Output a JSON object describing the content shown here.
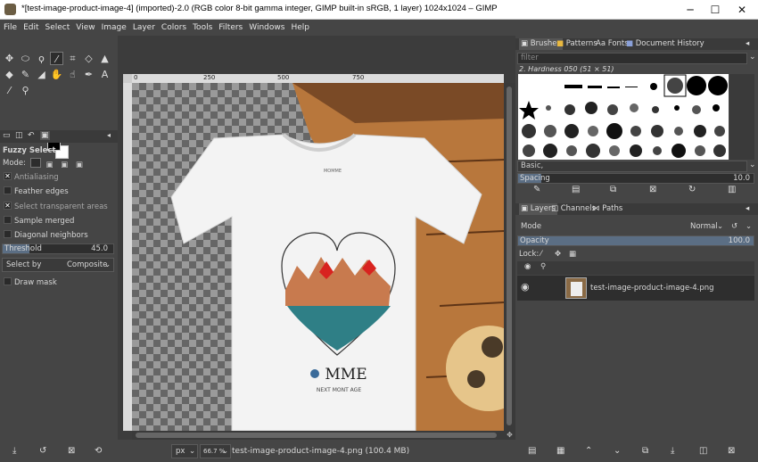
{
  "window": {
    "title": "*[test-image-product-image-4] (imported)-2.0 (RGB color 8-bit gamma integer, GIMP built-in sRGB, 1 layer) 1024x1024 – GIMP",
    "minimize_glyph": "─",
    "maximize_glyph": "☐",
    "close_glyph": "✕"
  },
  "menu": [
    "File",
    "Edit",
    "Select",
    "View",
    "Image",
    "Layer",
    "Colors",
    "Tools",
    "Filters",
    "Windows",
    "Help"
  ],
  "tool_options": {
    "title": "Fuzzy Select",
    "mode_label": "Mode:",
    "antialiasing": "Antialiasing",
    "feather_edges": "Feather edges",
    "select_transparent": "Select transparent areas",
    "sample_merged": "Sample merged",
    "diagonal_neighbors": "Diagonal neighbors",
    "threshold_label": "Threshold",
    "threshold_value": "45.0",
    "select_by_label": "Select by",
    "select_by_value": "Composite",
    "draw_mask": "Draw mask"
  },
  "rulers": {
    "h_ticks": [
      "0",
      "250",
      "500",
      "750"
    ]
  },
  "canvas": {
    "print_top": "MOMME",
    "print_logo": "MME",
    "print_sub": "NEXT MONT AGE"
  },
  "status": {
    "unit": "px",
    "zoom": "66.7 %",
    "info": "test-image-product-image-4.png (100.4 MB)"
  },
  "brushes_dock": {
    "tabs": [
      "Brushes",
      "Patterns",
      "Fonts",
      "Document History"
    ],
    "filter_placeholder": "filter",
    "brush_name": "2. Hardness 050 (51 × 51)",
    "tag": "Basic,",
    "spacing_label": "Spacing",
    "spacing_value": "10.0"
  },
  "layers_dock": {
    "tabs": [
      "Layers",
      "Channels",
      "Paths"
    ],
    "mode_label": "Mode",
    "mode_value": "Normal",
    "opacity_label": "Opacity",
    "opacity_value": "100.0",
    "lock_label": "Lock:",
    "layer_name": "test-image-product-image-4.png"
  }
}
